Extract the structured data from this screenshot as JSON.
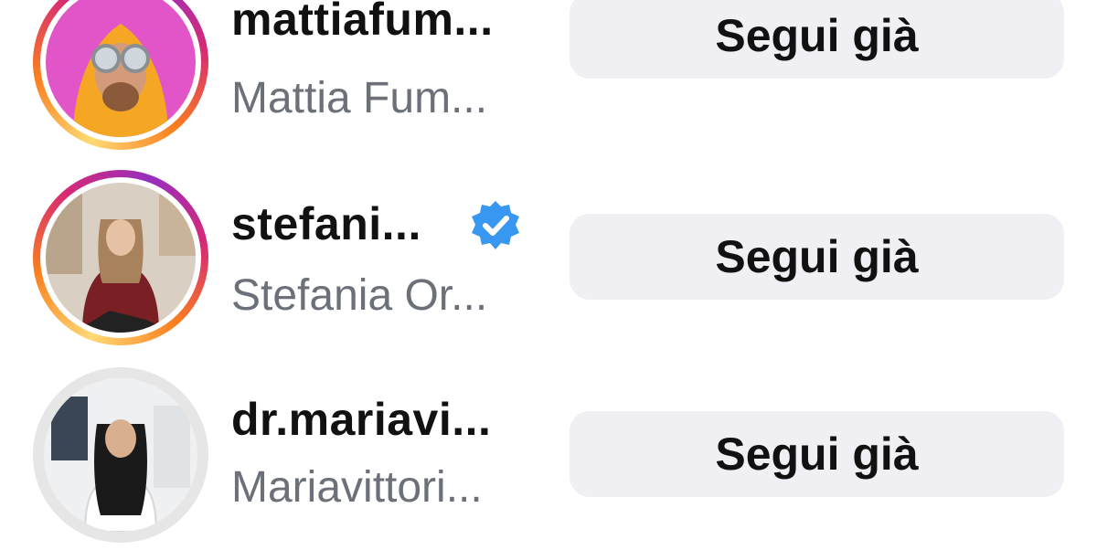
{
  "accounts": [
    {
      "username": "mattiafum...",
      "full_name": "Mattia Fum...",
      "follow_button": "Segui già",
      "has_story_ring": true,
      "verified": false
    },
    {
      "username": "stefani...",
      "full_name": "Stefania Or...",
      "follow_button": "Segui già",
      "has_story_ring": true,
      "verified": true
    },
    {
      "username": "dr.mariavi...",
      "full_name": "Mariavittori...",
      "follow_button": "Segui già",
      "has_story_ring": false,
      "verified": false
    }
  ],
  "colors": {
    "button_bg": "#efeff4",
    "verified_blue": "#3897f0",
    "secondary_text": "#6b7079"
  }
}
